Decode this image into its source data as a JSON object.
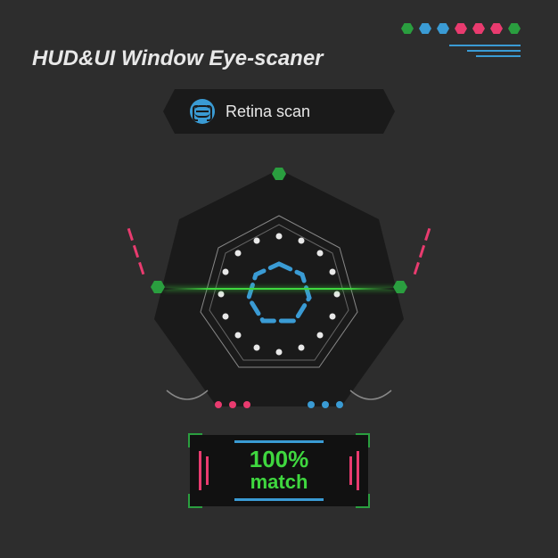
{
  "title": "HUD&UI Window Eye-scaner",
  "retina": {
    "label": "Retina scan"
  },
  "match": {
    "value": "100%",
    "label": "match"
  },
  "colors": {
    "green": "#3fd73f",
    "darkgreen": "#2a9e3f",
    "blue": "#3a9bd4",
    "pink": "#e93b6f"
  },
  "decor": {
    "topHex": [
      "#2a9e3f",
      "#3a9bd4",
      "#3a9bd4",
      "#e93b6f",
      "#e93b6f",
      "#e93b6f",
      "#2a9e3f"
    ],
    "bottomLeftDots": [
      "#e93b6f",
      "#e93b6f",
      "#e93b6f"
    ],
    "bottomRightDots": [
      "#3a9bd4",
      "#3a9bd4",
      "#3a9bd4"
    ]
  }
}
